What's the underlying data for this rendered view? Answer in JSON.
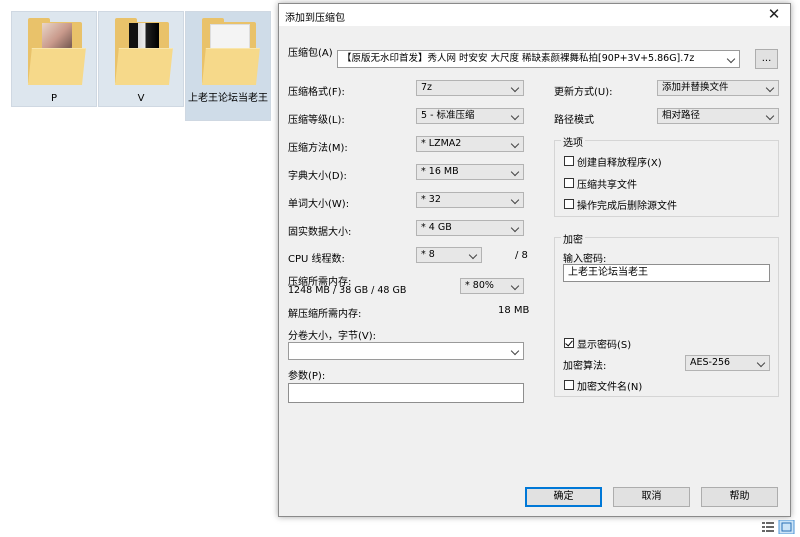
{
  "desktop": {
    "folders": [
      {
        "label": "P"
      },
      {
        "label": "V"
      },
      {
        "label": "上老王论坛当老王"
      }
    ]
  },
  "dialog": {
    "title": "添加到压缩包",
    "archive_label": "压缩包(A)",
    "archive_value": "【原版无水印首发】秀人网 时安安 大尺度 稀缺素颜裸舞私拍[90P+3V+5.86G].7z",
    "browse_label": "...",
    "left": {
      "format_label": "压缩格式(F):",
      "format_value": "7z",
      "level_label": "压缩等级(L):",
      "level_value": "5 - 标准压缩",
      "method_label": "压缩方法(M):",
      "method_value": "* LZMA2",
      "dict_label": "字典大小(D):",
      "dict_value": "* 16 MB",
      "word_label": "单词大小(W):",
      "word_value": "* 32",
      "solid_label": "固实数据大小:",
      "solid_value": "* 4 GB",
      "cpu_label": "CPU 线程数:",
      "cpu_value": "* 8",
      "cpu_total": "/ 8",
      "mem_label": "压缩所需内存:",
      "mem_value": "1248 MB / 38 GB / 48 GB",
      "mem_percent": "* 80%",
      "decomp_label": "解压缩所需内存:",
      "decomp_value": "18 MB",
      "split_label": "分卷大小，字节(V):",
      "split_value": "",
      "params_label": "参数(P):",
      "params_value": ""
    },
    "right": {
      "update_label": "更新方式(U):",
      "update_value": "添加并替换文件",
      "path_label": "路径模式",
      "path_value": "相对路径",
      "options_title": "选项",
      "opt_sfx": "创建自释放程序(X)",
      "opt_shared": "压缩共享文件",
      "opt_delete": "操作完成后删除源文件",
      "enc_title": "加密",
      "pw_label": "输入密码:",
      "pw_value": "上老王论坛当老王",
      "show_pw": "显示密码(S)",
      "enc_method_label": "加密算法:",
      "enc_method_value": "AES-256",
      "enc_names": "加密文件名(N)"
    },
    "buttons": {
      "ok": "确定",
      "cancel": "取消",
      "help": "帮助"
    }
  }
}
